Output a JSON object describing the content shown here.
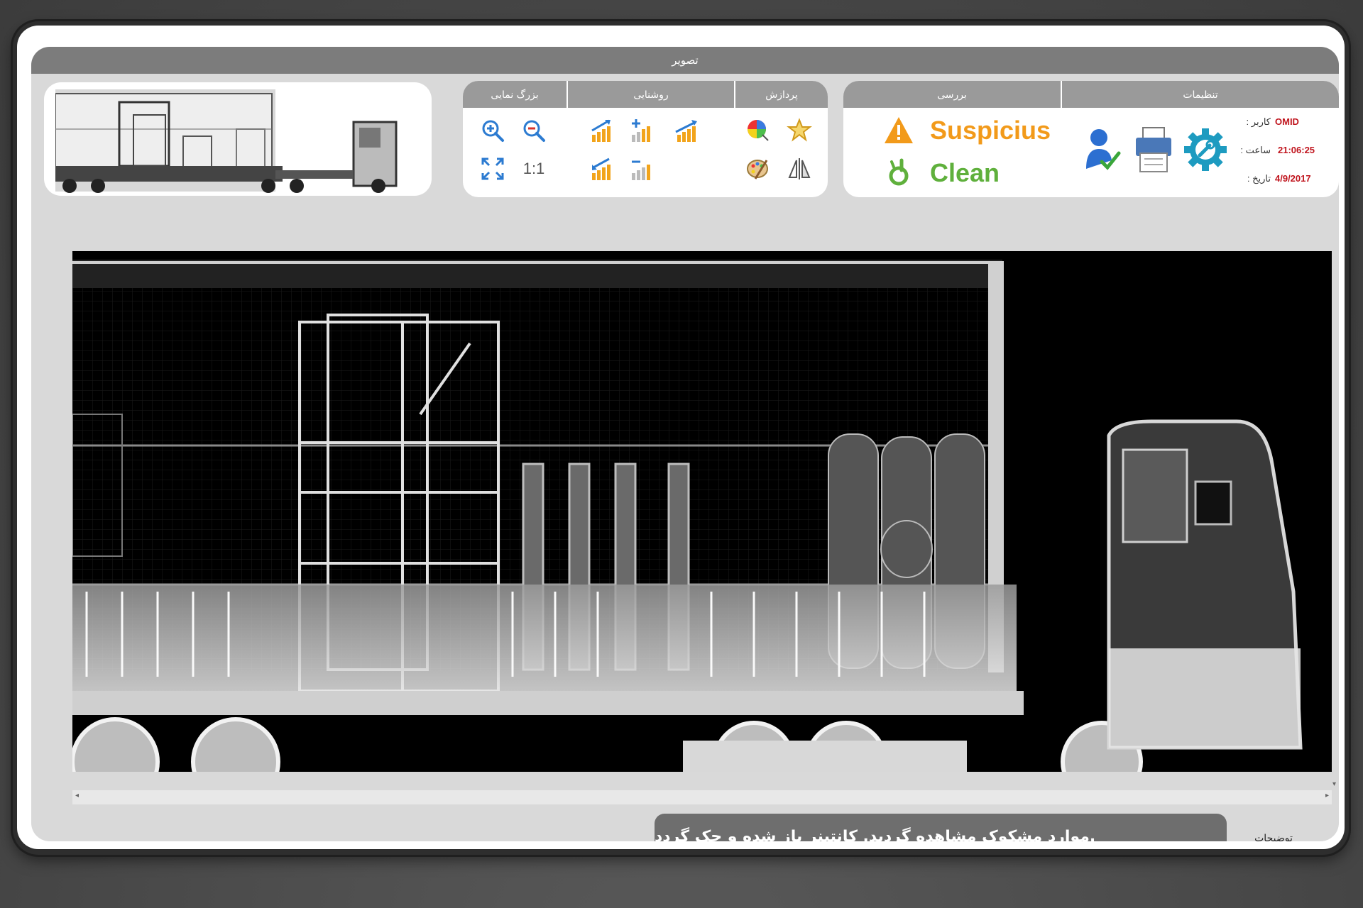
{
  "window": {
    "title": "تصویر"
  },
  "groups": {
    "zoom": {
      "title": "بزرگ نمایی",
      "buttons": [
        "zoom-in-icon",
        "zoom-out-icon",
        "fit-screen-icon",
        "actual-size"
      ],
      "actual_size_label": "1:1"
    },
    "brightness": {
      "title": "روشنایی",
      "buttons": [
        "brightness-up-icon",
        "brightness-plus-icon",
        "contrast-up-icon",
        "brightness-down-icon",
        "brightness-minus-icon"
      ]
    },
    "processing": {
      "title": "پردازش",
      "buttons": [
        "color-map-icon",
        "star-filter-icon",
        "palette-icon",
        "mirror-icon"
      ]
    },
    "review": {
      "title": "بررسی",
      "suspicious_label": "Suspicius",
      "clean_label": "Clean",
      "colors": {
        "suspicious": "#f29a1a",
        "clean": "#5fb03c"
      }
    },
    "settings": {
      "title": "تنظیمات",
      "buttons": [
        "user-approve-icon",
        "printer-icon",
        "settings-gear-icon"
      ]
    }
  },
  "info": {
    "user_label": ": کاربر",
    "user_value": "OMID",
    "time_label": ": ساعت",
    "time_value": "21:06:25",
    "date_label": ": تاریخ",
    "date_value": "4/9/2017"
  },
  "description": {
    "label": "توضیحات",
    "text": ".موارد مشکوک مشاهده گردید. کانتینر باز شده و جک گردد"
  }
}
